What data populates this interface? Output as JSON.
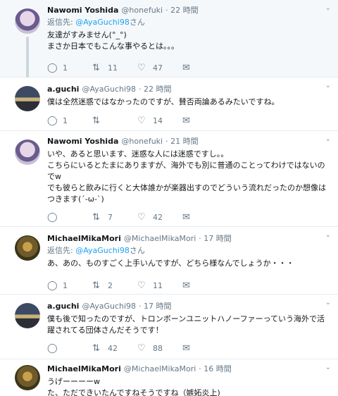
{
  "tweets": [
    {
      "name": "Nawomi Yoshida",
      "handle": "@honefuki",
      "time": "· 22 時間",
      "reply_prefix": "返信先:",
      "reply_handle": "@AyaGuchi98",
      "reply_suffix": "さん",
      "text": "友達がすみません(°_°)\nまさか日本でもこんな事やるとは。。。",
      "reply_count": "1",
      "retweet_count": "11",
      "like_count": "47"
    },
    {
      "name": "a.guchi",
      "handle": "@AyaGuchi98",
      "time": "· 22 時間",
      "text": "僕は全然迷惑ではなかったのですが、賛否両論あるみたいですね。",
      "reply_count": "1",
      "retweet_count": "",
      "like_count": "14"
    },
    {
      "name": "Nawomi Yoshida",
      "handle": "@honefuki",
      "time": "· 21 時間",
      "text": "いや、あると思います、迷惑な人には迷惑ですし。。\nこちらにいるとたまにありますが、海外でも別に普通のことってわけではないのでw\nでも彼らと飲みに行くと大体誰かが楽器出すのでどういう流れだったのか想像はつきます(´-ω-`)",
      "reply_count": "",
      "retweet_count": "7",
      "like_count": "42"
    },
    {
      "name": "MichaelMikaMori",
      "handle": "@MichaelMikaMori",
      "time": "· 17 時間",
      "reply_prefix": "返信先:",
      "reply_handle": "@AyaGuchi98",
      "reply_suffix": "さん",
      "text": "あ、あの、ものすごく上手いんですが、どちら様なんでしょうか・・・",
      "reply_count": "1",
      "retweet_count": "2",
      "like_count": "11"
    },
    {
      "name": "a.guchi",
      "handle": "@AyaGuchi98",
      "time": "· 17 時間",
      "text": "僕も後で知ったのですが、トロンボーンユニットハノーファーっていう海外で活躍されてる団体さんだそうです！",
      "reply_count": "",
      "retweet_count": "42",
      "like_count": "88"
    },
    {
      "name": "MichaelMikaMori",
      "handle": "@MichaelMikaMori",
      "time": "· 16 時間",
      "text": "うげーーーーw\nた、ただできいたんですねそうですね（嫉妬炎上)"
    }
  ],
  "icons": {
    "reply": "reply-icon",
    "retweet": "retweet-icon",
    "like": "heart-icon",
    "dm": "envelope-icon",
    "more": "chevron-down-icon"
  },
  "colors": {
    "link": "#1da1f2",
    "secondary_text": "#657786",
    "thread_line": "#ccd6dd",
    "highlight_bg": "#f5f8fa"
  }
}
